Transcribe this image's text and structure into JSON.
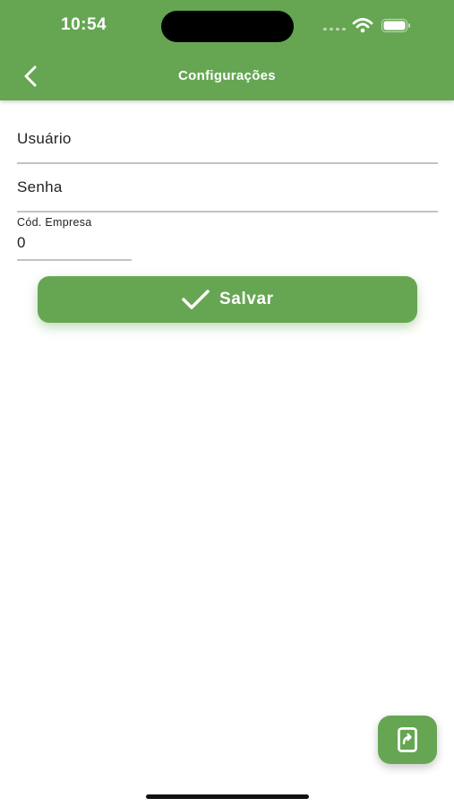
{
  "status_bar": {
    "time": "10:54"
  },
  "header": {
    "title": "Configurações",
    "back_icon": "chevron-left-icon"
  },
  "form": {
    "usuario_placeholder": "Usuário",
    "senha_placeholder": "Senha",
    "empresa_label": "Cód. Empresa",
    "empresa_value": "0"
  },
  "save_button": {
    "label": "Salvar",
    "icon": "check-icon"
  },
  "fab": {
    "icon": "share-document-icon"
  },
  "colors": {
    "primary": "#66a653",
    "text": "#222222",
    "divider": "#c2c2c2",
    "background": "#ffffff"
  }
}
